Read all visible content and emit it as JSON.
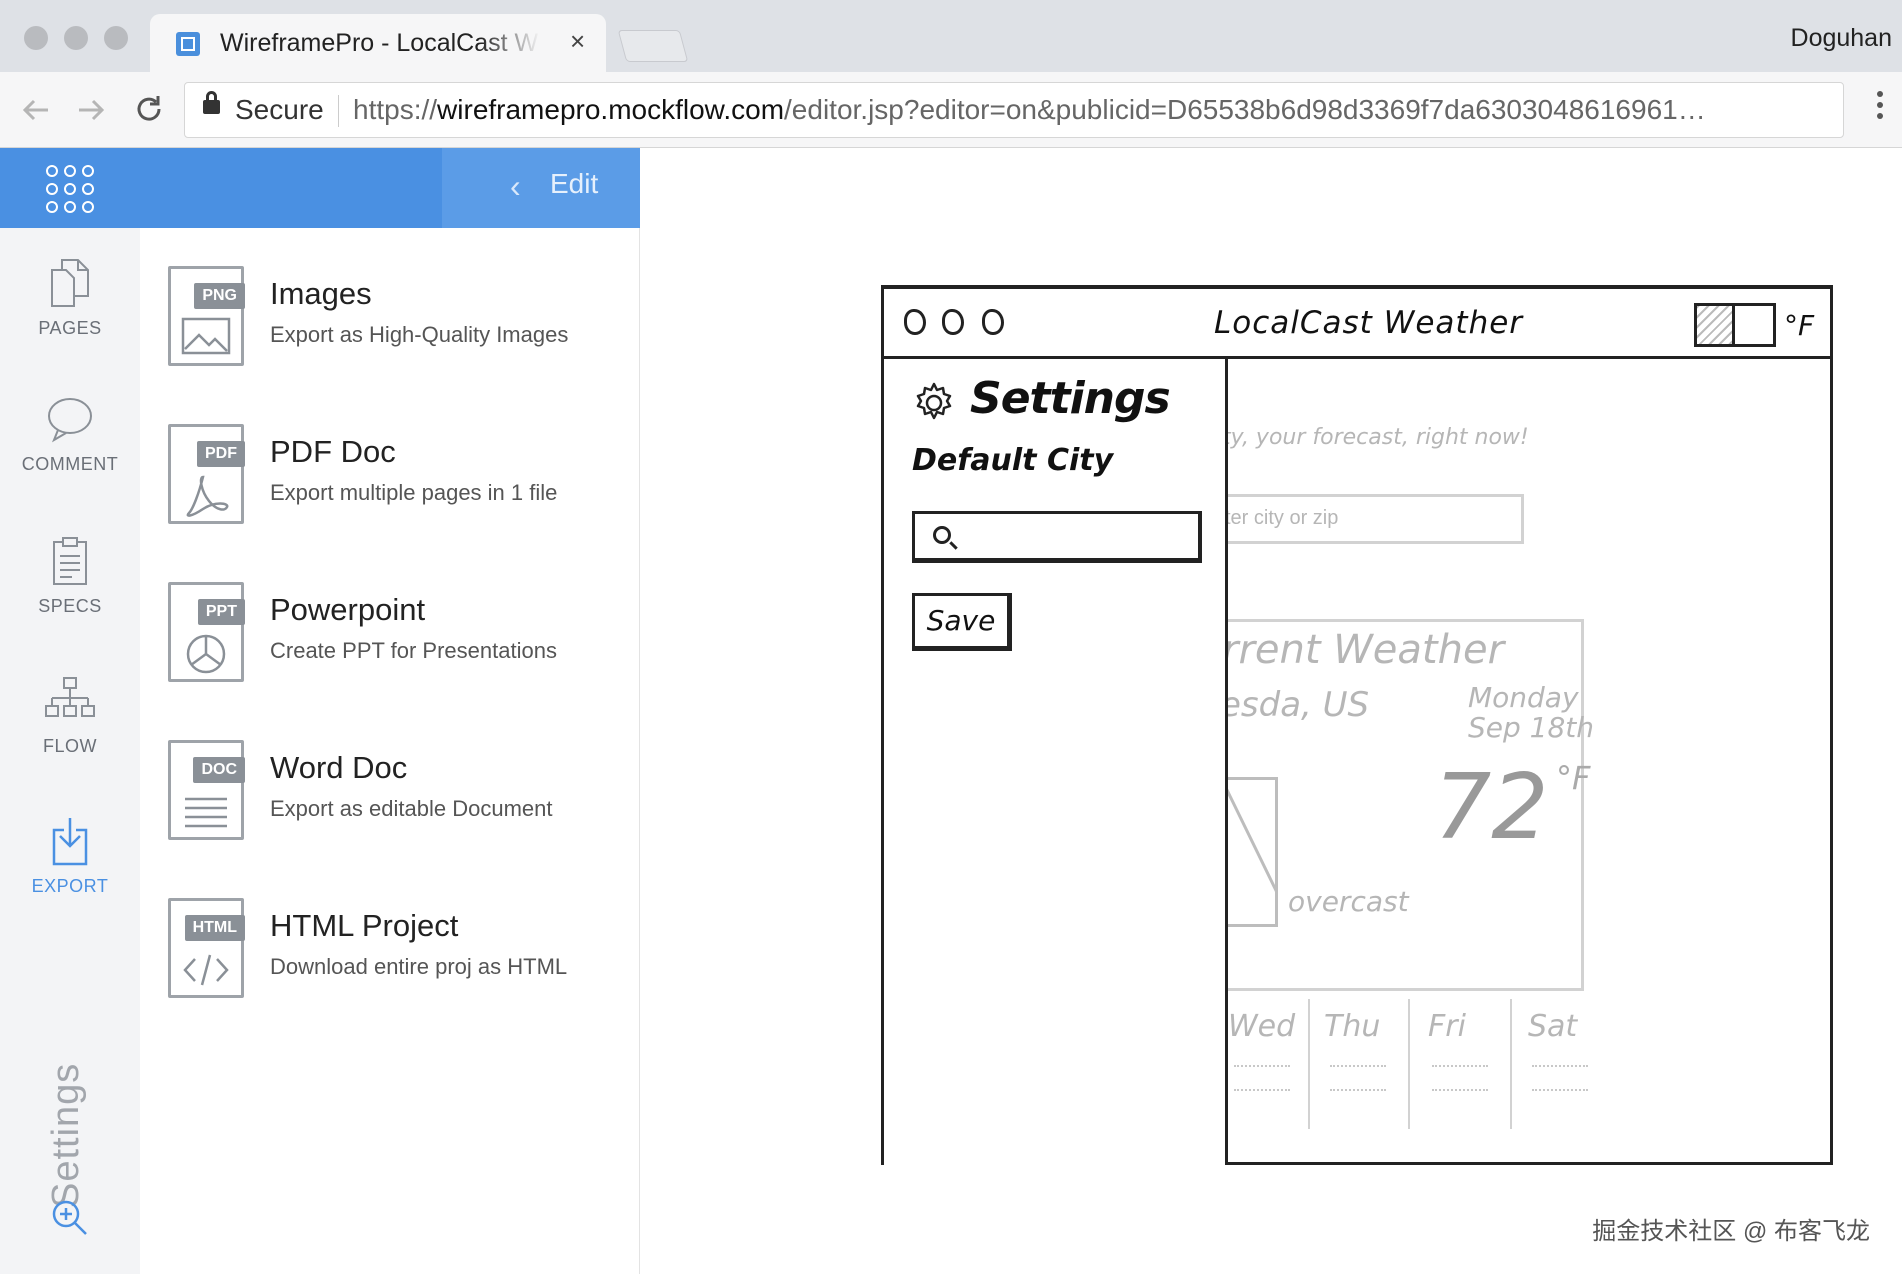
{
  "browser": {
    "tab_title": "WireframePro - LocalCast Wea",
    "tab_close": "×",
    "profile_name": "Doguhan",
    "secure_label": "Secure",
    "url_scheme": "https://",
    "url_host": "wireframepro.mockflow.com",
    "url_path": "/editor.jsp?editor=on&publicid=D65538b6d98d3369f7da6303048616961…"
  },
  "topbar": {
    "back_chevron": "‹",
    "edit_label": "Edit"
  },
  "rail": {
    "pages": "PAGES",
    "comment": "COMMENT",
    "specs": "SPECS",
    "flow": "FLOW",
    "export": "EXPORT",
    "settings": "Settings"
  },
  "export_options": [
    {
      "badge": "PNG",
      "title": "Images",
      "desc": "Export as High-Quality Images"
    },
    {
      "badge": "PDF",
      "title": "PDF Doc",
      "desc": "Export multiple pages in 1 file"
    },
    {
      "badge": "PPT",
      "title": "Powerpoint",
      "desc": "Create PPT for Presentations"
    },
    {
      "badge": "DOC",
      "title": "Word Doc",
      "desc": "Export as editable Document"
    },
    {
      "badge": "HTML",
      "title": "HTML Project",
      "desc": "Download entire proj as HTML"
    }
  ],
  "wireframe": {
    "title": "LocalCast Weather",
    "unit_toggle": "°F",
    "tagline_partial": "ty, your forecast, right now!",
    "search_placeholder_partial": "ter city or zip",
    "card_title_partial": "rrent Weather",
    "location_partial": "esda, US",
    "day": "Monday",
    "date": "Sep 18th",
    "temp": "72",
    "temp_unit": "°F",
    "condition": "overcast",
    "days": [
      "Wed",
      "Thu",
      "Fri",
      "Sat"
    ],
    "settings": {
      "heading": "Settings",
      "default_city_label": "Default City",
      "save_label": "Save"
    }
  },
  "watermark": "掘金技术社区 @ 布客飞龙",
  "colors": {
    "accent": "#4a90e2",
    "rail_bg": "#f3f4f6",
    "muted_text": "#6a6f77"
  }
}
